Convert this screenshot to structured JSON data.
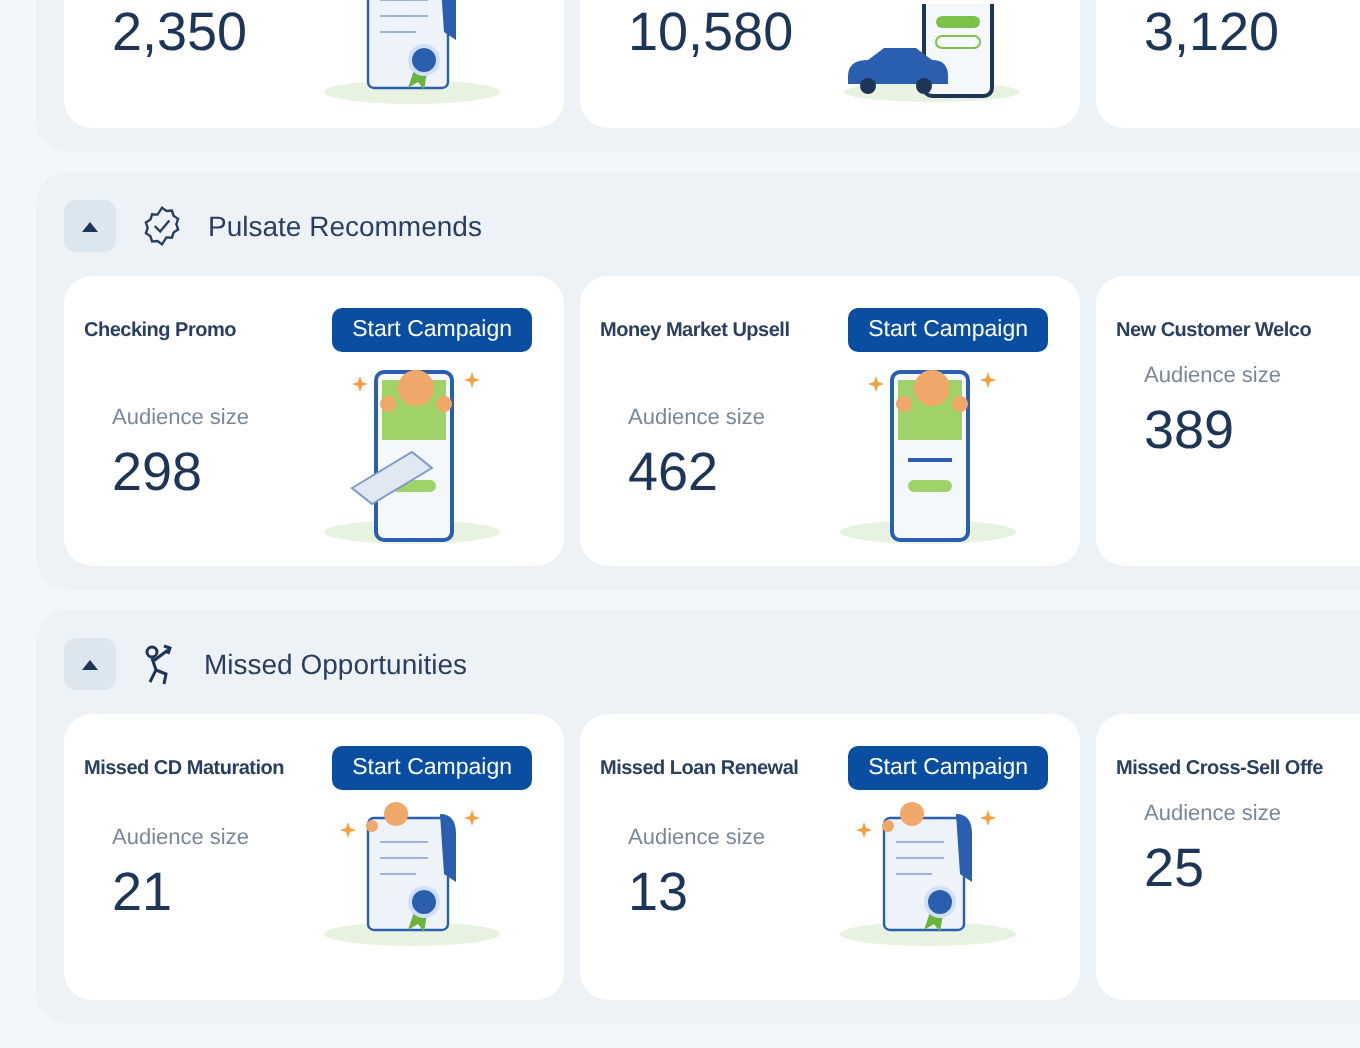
{
  "top_cards": [
    {
      "value": "2,350",
      "kind": "certificate"
    },
    {
      "value": "10,580",
      "kind": "phone_car"
    },
    {
      "value": "3,120",
      "kind": "plain"
    }
  ],
  "sections": [
    {
      "title": "Pulsate Recommends",
      "kind": "recommend",
      "expanded": true,
      "cards": [
        {
          "title": "Checking Promo",
          "button": "Start Campaign",
          "label": "Audience size",
          "value": "298",
          "kind": "phone_check"
        },
        {
          "title": "Money Market Upsell",
          "button": "Start Campaign",
          "label": "Audience size",
          "value": "462",
          "kind": "phone_promo"
        },
        {
          "title": "New Customer Welco",
          "label": "Audience size",
          "value": "389",
          "kind": "plain"
        }
      ]
    },
    {
      "title": "Missed Opportunities",
      "kind": "missed",
      "expanded": true,
      "cards": [
        {
          "title": "Missed CD Maturation",
          "button": "Start Campaign",
          "label": "Audience size",
          "value": "21",
          "kind": "certificate"
        },
        {
          "title": "Missed Loan Renewal",
          "button": "Start Campaign",
          "label": "Audience size",
          "value": "13",
          "kind": "certificate"
        },
        {
          "title": "Missed Cross-Sell Offe",
          "label": "Audience size",
          "value": "25",
          "kind": "plain"
        }
      ]
    }
  ]
}
